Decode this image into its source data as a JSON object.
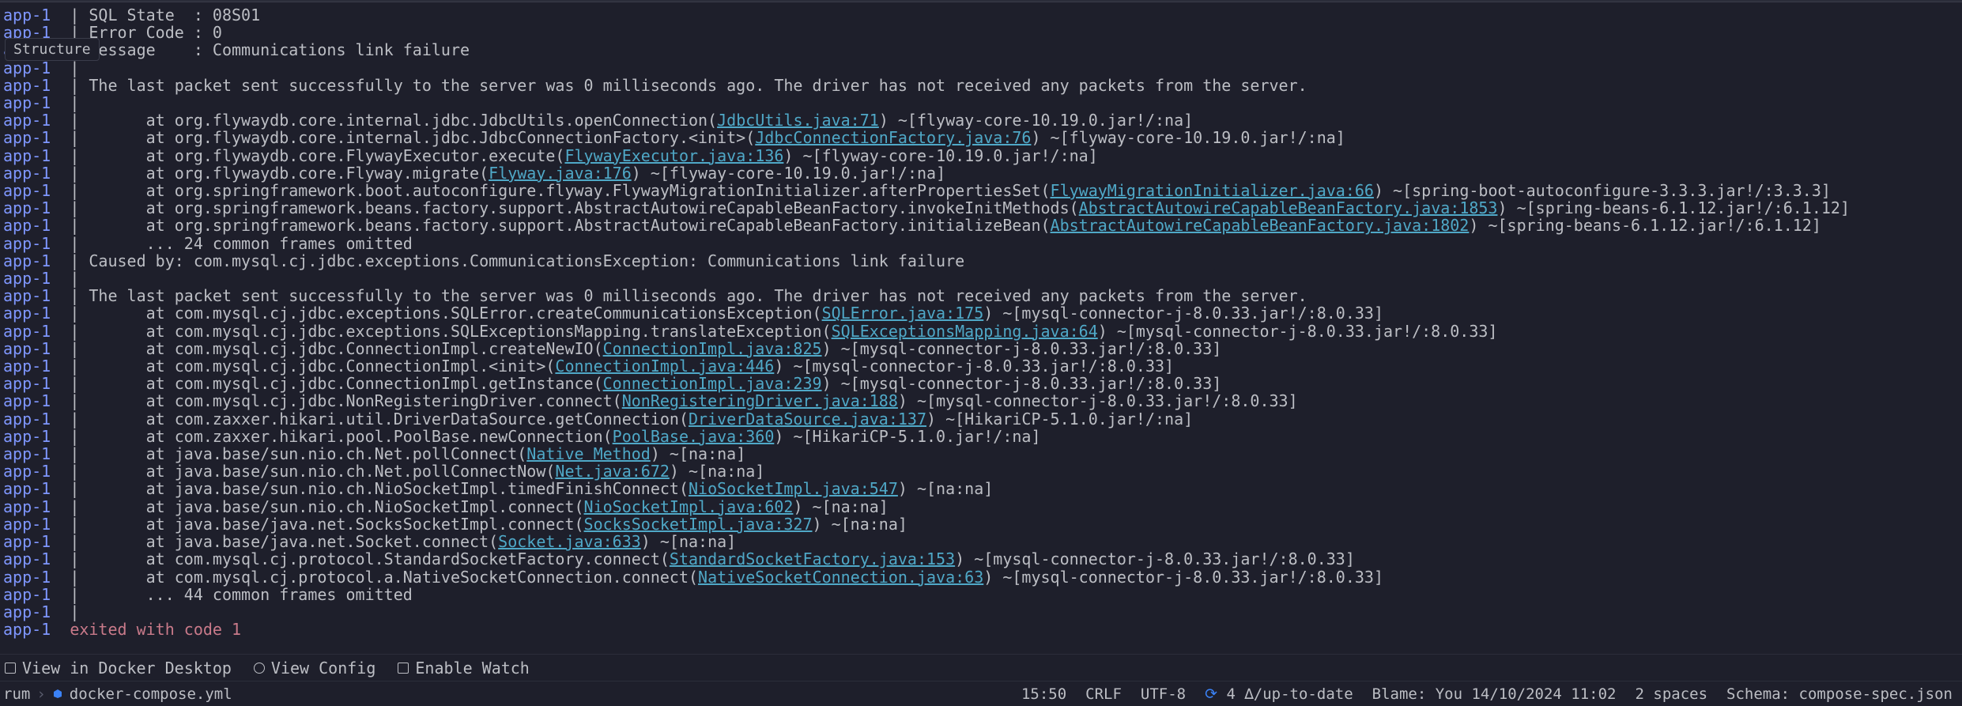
{
  "structure_tab": "Structure",
  "source_label": "app-1",
  "log": [
    {
      "pre": "",
      "segs": [
        {
          "t": "txt",
          "v": "| SQL State  : 08S01"
        }
      ]
    },
    {
      "pre": "",
      "segs": [
        {
          "t": "txt",
          "v": "| Error Code : 0"
        }
      ]
    },
    {
      "pre": "",
      "segs": [
        {
          "t": "txt",
          "v": "| Message    : Communications link failure"
        }
      ]
    },
    {
      "pre": "",
      "segs": [
        {
          "t": "txt",
          "v": "| "
        }
      ]
    },
    {
      "pre": "",
      "segs": [
        {
          "t": "txt",
          "v": "| The last packet sent successfully to the server was 0 milliseconds ago. The driver has not received any packets from the server."
        }
      ]
    },
    {
      "pre": "",
      "segs": [
        {
          "t": "txt",
          "v": "| "
        }
      ]
    },
    {
      "pre": "",
      "segs": [
        {
          "t": "txt",
          "v": "|       at org.flywaydb.core.internal.jdbc.JdbcUtils.openConnection("
        },
        {
          "t": "lnk",
          "v": "JdbcUtils.java:71"
        },
        {
          "t": "txt",
          "v": ") ~[flyway-core-10.19.0.jar!/:na]"
        }
      ]
    },
    {
      "pre": "",
      "segs": [
        {
          "t": "txt",
          "v": "|       at org.flywaydb.core.internal.jdbc.JdbcConnectionFactory.<init>("
        },
        {
          "t": "lnk",
          "v": "JdbcConnectionFactory.java:76"
        },
        {
          "t": "txt",
          "v": ") ~[flyway-core-10.19.0.jar!/:na]"
        }
      ]
    },
    {
      "pre": "",
      "segs": [
        {
          "t": "txt",
          "v": "|       at org.flywaydb.core.FlywayExecutor.execute("
        },
        {
          "t": "lnk",
          "v": "FlywayExecutor.java:136"
        },
        {
          "t": "txt",
          "v": ") ~[flyway-core-10.19.0.jar!/:na]"
        }
      ]
    },
    {
      "pre": "",
      "segs": [
        {
          "t": "txt",
          "v": "|       at org.flywaydb.core.Flyway.migrate("
        },
        {
          "t": "lnk",
          "v": "Flyway.java:176"
        },
        {
          "t": "txt",
          "v": ") ~[flyway-core-10.19.0.jar!/:na]"
        }
      ]
    },
    {
      "pre": "",
      "segs": [
        {
          "t": "txt",
          "v": "|       at org.springframework.boot.autoconfigure.flyway.FlywayMigrationInitializer.afterPropertiesSet("
        },
        {
          "t": "lnk",
          "v": "FlywayMigrationInitializer.java:66"
        },
        {
          "t": "txt",
          "v": ") ~[spring-boot-autoconfigure-3.3.3.jar!/:3.3.3]"
        }
      ]
    },
    {
      "pre": "",
      "segs": [
        {
          "t": "txt",
          "v": "|       at org.springframework.beans.factory.support.AbstractAutowireCapableBeanFactory.invokeInitMethods("
        },
        {
          "t": "lnk",
          "v": "AbstractAutowireCapableBeanFactory.java:1853"
        },
        {
          "t": "txt",
          "v": ") ~[spring-beans-6.1.12.jar!/:6.1.12]"
        }
      ]
    },
    {
      "pre": "",
      "segs": [
        {
          "t": "txt",
          "v": "|       at org.springframework.beans.factory.support.AbstractAutowireCapableBeanFactory.initializeBean("
        },
        {
          "t": "lnk",
          "v": "AbstractAutowireCapableBeanFactory.java:1802"
        },
        {
          "t": "txt",
          "v": ") ~[spring-beans-6.1.12.jar!/:6.1.12]"
        }
      ]
    },
    {
      "pre": "",
      "segs": [
        {
          "t": "txt",
          "v": "|       ... 24 common frames omitted"
        }
      ]
    },
    {
      "pre": "",
      "segs": [
        {
          "t": "txt",
          "v": "| Caused by: com.mysql.cj.jdbc.exceptions.CommunicationsException: Communications link failure"
        }
      ]
    },
    {
      "pre": "",
      "segs": [
        {
          "t": "txt",
          "v": "| "
        }
      ]
    },
    {
      "pre": "",
      "segs": [
        {
          "t": "txt",
          "v": "| The last packet sent successfully to the server was 0 milliseconds ago. The driver has not received any packets from the server."
        }
      ]
    },
    {
      "pre": "",
      "segs": [
        {
          "t": "txt",
          "v": "|       at com.mysql.cj.jdbc.exceptions.SQLError.createCommunicationsException("
        },
        {
          "t": "lnk",
          "v": "SQLError.java:175"
        },
        {
          "t": "txt",
          "v": ") ~[mysql-connector-j-8.0.33.jar!/:8.0.33]"
        }
      ]
    },
    {
      "pre": "",
      "segs": [
        {
          "t": "txt",
          "v": "|       at com.mysql.cj.jdbc.exceptions.SQLExceptionsMapping.translateException("
        },
        {
          "t": "lnk",
          "v": "SQLExceptionsMapping.java:64"
        },
        {
          "t": "txt",
          "v": ") ~[mysql-connector-j-8.0.33.jar!/:8.0.33]"
        }
      ]
    },
    {
      "pre": "",
      "segs": [
        {
          "t": "txt",
          "v": "|       at com.mysql.cj.jdbc.ConnectionImpl.createNewIO("
        },
        {
          "t": "lnk",
          "v": "ConnectionImpl.java:825"
        },
        {
          "t": "txt",
          "v": ") ~[mysql-connector-j-8.0.33.jar!/:8.0.33]"
        }
      ]
    },
    {
      "pre": "",
      "segs": [
        {
          "t": "txt",
          "v": "|       at com.mysql.cj.jdbc.ConnectionImpl.<init>("
        },
        {
          "t": "lnk",
          "v": "ConnectionImpl.java:446"
        },
        {
          "t": "txt",
          "v": ") ~[mysql-connector-j-8.0.33.jar!/:8.0.33]"
        }
      ]
    },
    {
      "pre": "",
      "segs": [
        {
          "t": "txt",
          "v": "|       at com.mysql.cj.jdbc.ConnectionImpl.getInstance("
        },
        {
          "t": "lnk",
          "v": "ConnectionImpl.java:239"
        },
        {
          "t": "txt",
          "v": ") ~[mysql-connector-j-8.0.33.jar!/:8.0.33]"
        }
      ]
    },
    {
      "pre": "",
      "segs": [
        {
          "t": "txt",
          "v": "|       at com.mysql.cj.jdbc.NonRegisteringDriver.connect("
        },
        {
          "t": "lnk",
          "v": "NonRegisteringDriver.java:188"
        },
        {
          "t": "txt",
          "v": ") ~[mysql-connector-j-8.0.33.jar!/:8.0.33]"
        }
      ]
    },
    {
      "pre": "",
      "segs": [
        {
          "t": "txt",
          "v": "|       at com.zaxxer.hikari.util.DriverDataSource.getConnection("
        },
        {
          "t": "lnk",
          "v": "DriverDataSource.java:137"
        },
        {
          "t": "txt",
          "v": ") ~[HikariCP-5.1.0.jar!/:na]"
        }
      ]
    },
    {
      "pre": "",
      "segs": [
        {
          "t": "txt",
          "v": "|       at com.zaxxer.hikari.pool.PoolBase.newConnection("
        },
        {
          "t": "lnk",
          "v": "PoolBase.java:360"
        },
        {
          "t": "txt",
          "v": ") ~[HikariCP-5.1.0.jar!/:na]"
        }
      ]
    },
    {
      "pre": "",
      "segs": [
        {
          "t": "txt",
          "v": "|       at java.base/sun.nio.ch.Net.pollConnect("
        },
        {
          "t": "lnk",
          "v": "Native Method"
        },
        {
          "t": "txt",
          "v": ") ~[na:na]"
        }
      ]
    },
    {
      "pre": "",
      "segs": [
        {
          "t": "txt",
          "v": "|       at java.base/sun.nio.ch.Net.pollConnectNow("
        },
        {
          "t": "lnk",
          "v": "Net.java:672"
        },
        {
          "t": "txt",
          "v": ") ~[na:na]"
        }
      ]
    },
    {
      "pre": "",
      "segs": [
        {
          "t": "txt",
          "v": "|       at java.base/sun.nio.ch.NioSocketImpl.timedFinishConnect("
        },
        {
          "t": "lnk",
          "v": "NioSocketImpl.java:547"
        },
        {
          "t": "txt",
          "v": ") ~[na:na]"
        }
      ]
    },
    {
      "pre": "",
      "segs": [
        {
          "t": "txt",
          "v": "|       at java.base/sun.nio.ch.NioSocketImpl.connect("
        },
        {
          "t": "lnk",
          "v": "NioSocketImpl.java:602"
        },
        {
          "t": "txt",
          "v": ") ~[na:na]"
        }
      ]
    },
    {
      "pre": "",
      "segs": [
        {
          "t": "txt",
          "v": "|       at java.base/java.net.SocksSocketImpl.connect("
        },
        {
          "t": "lnk",
          "v": "SocksSocketImpl.java:327"
        },
        {
          "t": "txt",
          "v": ") ~[na:na]"
        }
      ]
    },
    {
      "pre": "",
      "segs": [
        {
          "t": "txt",
          "v": "|       at java.base/java.net.Socket.connect("
        },
        {
          "t": "lnk",
          "v": "Socket.java:633"
        },
        {
          "t": "txt",
          "v": ") ~[na:na]"
        }
      ]
    },
    {
      "pre": "",
      "segs": [
        {
          "t": "txt",
          "v": "|       at com.mysql.cj.protocol.StandardSocketFactory.connect("
        },
        {
          "t": "lnk",
          "v": "StandardSocketFactory.java:153"
        },
        {
          "t": "txt",
          "v": ") ~[mysql-connector-j-8.0.33.jar!/:8.0.33]"
        }
      ]
    },
    {
      "pre": "",
      "segs": [
        {
          "t": "txt",
          "v": "|       at com.mysql.cj.protocol.a.NativeSocketConnection.connect("
        },
        {
          "t": "lnk",
          "v": "NativeSocketConnection.java:63"
        },
        {
          "t": "txt",
          "v": ") ~[mysql-connector-j-8.0.33.jar!/:8.0.33]"
        }
      ]
    },
    {
      "pre": "",
      "segs": [
        {
          "t": "txt",
          "v": "|       ... 44 common frames omitted"
        }
      ]
    },
    {
      "pre": "",
      "segs": [
        {
          "t": "txt",
          "v": "| "
        }
      ]
    },
    {
      "pre": "",
      "segs": [
        {
          "t": "err",
          "v": "exited with code 1"
        }
      ],
      "exit": true
    }
  ],
  "toolbar": {
    "view_desktop": "View in Docker Desktop",
    "view_config": "View Config",
    "enable_watch": "Enable Watch"
  },
  "statusbar": {
    "breadcrumb_root": "rum",
    "breadcrumb_file": "docker-compose.yml",
    "cursor": "15:50",
    "line_ending": "CRLF",
    "encoding": "UTF-8",
    "sync": "4 ∆/up-to-date",
    "blame": "Blame: You 14/10/2024 11:02",
    "indent": "2 spaces",
    "schema": "Schema: compose-spec.json"
  }
}
